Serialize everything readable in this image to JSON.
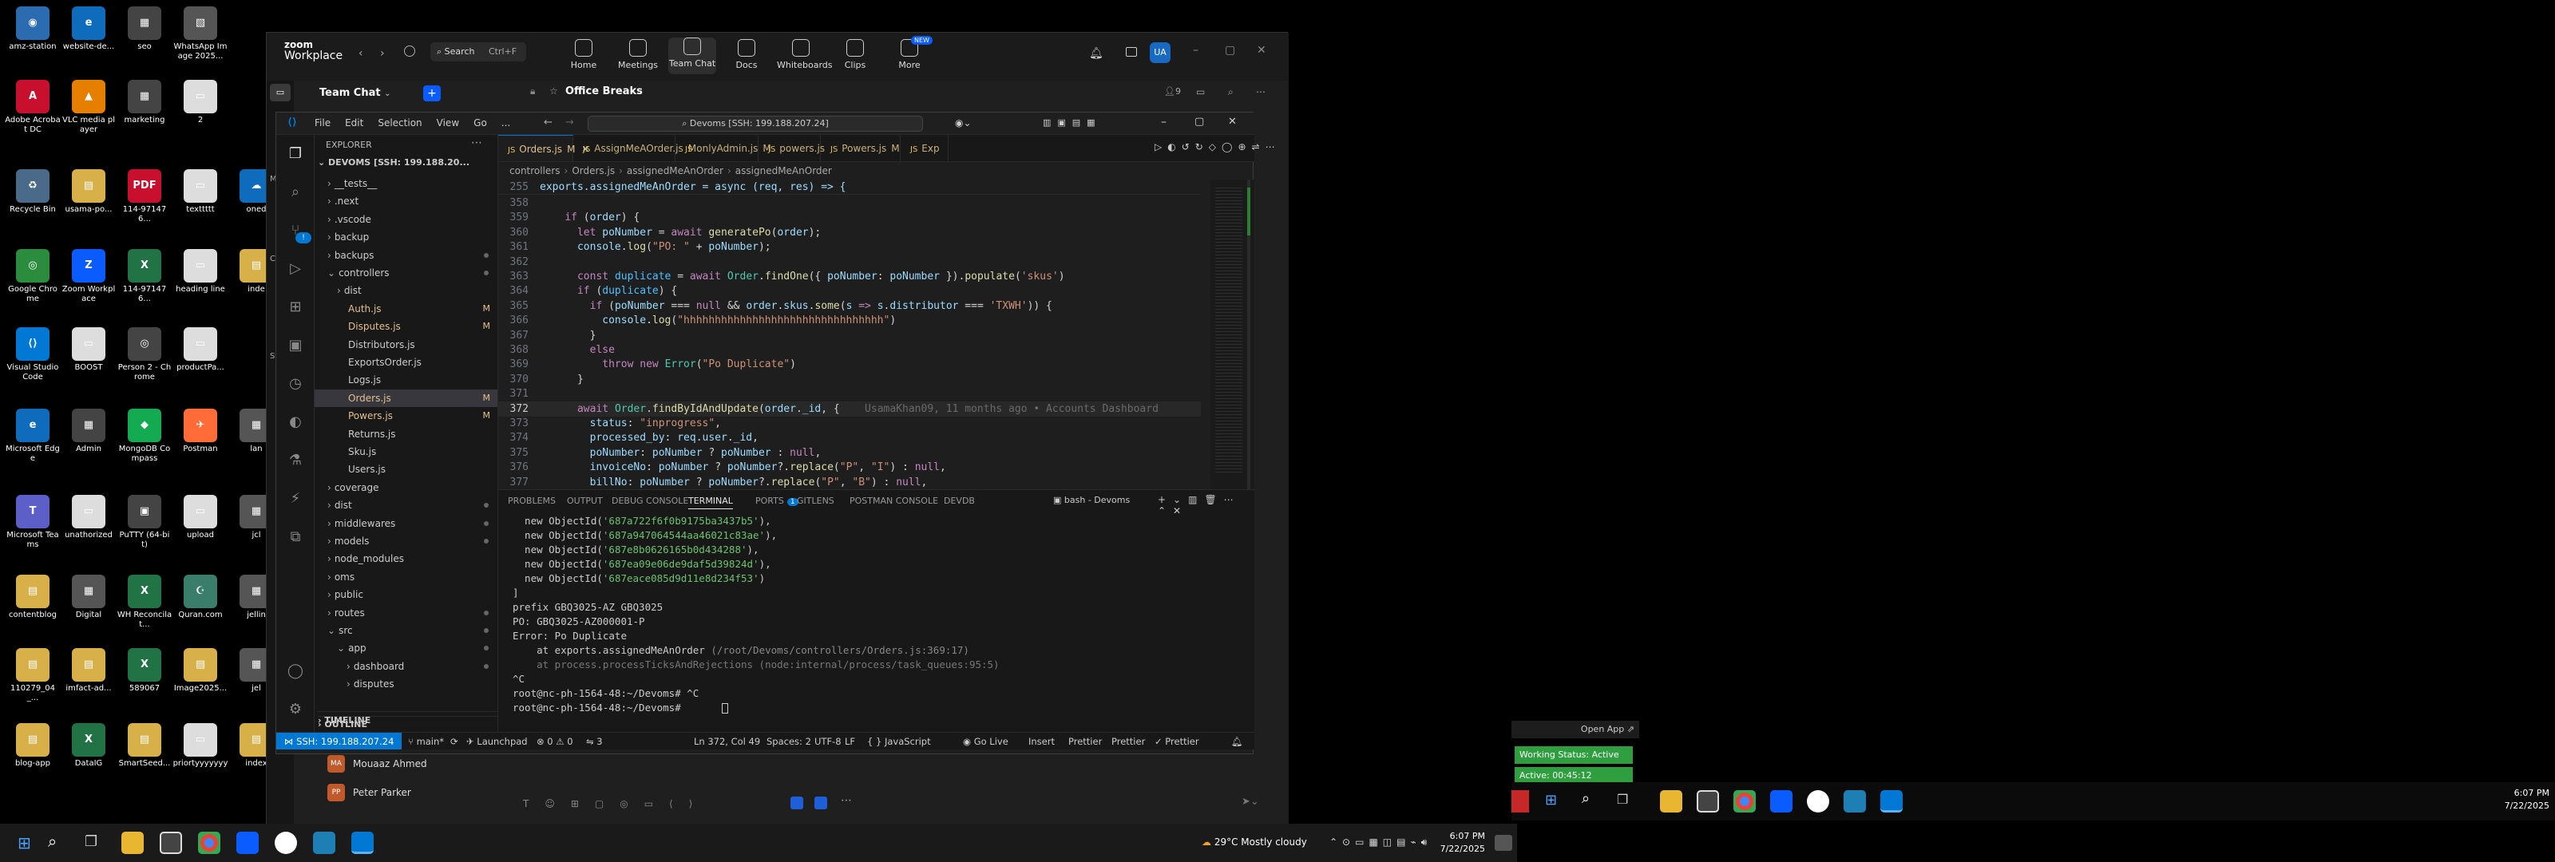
{
  "desktop": {
    "icons": [
      {
        "label": "amz-station",
        "color": "#2b6cb0",
        "glyph": "◉"
      },
      {
        "label": "website-de...",
        "color": "#0f6cbd",
        "glyph": "e"
      },
      {
        "label": "seo",
        "color": "#444",
        "glyph": "▦"
      },
      {
        "label": "WhatsApp Image 2025...",
        "color": "#555",
        "glyph": "▧"
      },
      {
        "label": "Adobe Acrobat DC",
        "color": "#c8102e",
        "glyph": "A"
      },
      {
        "label": "VLC media player",
        "color": "#e67e00",
        "glyph": "▲"
      },
      {
        "label": "marketing",
        "color": "#444",
        "glyph": "▦"
      },
      {
        "label": "2",
        "color": "#ddd",
        "glyph": "▭"
      },
      {
        "label": "Recycle Bin",
        "color": "#4a6a8a",
        "glyph": "♻"
      },
      {
        "label": "usama-po...",
        "color": "#d8b04a",
        "glyph": "▤"
      },
      {
        "label": "114-971476...",
        "color": "#c8102e",
        "glyph": "PDF"
      },
      {
        "label": "texttttt",
        "color": "#ddd",
        "glyph": "▭"
      },
      {
        "label": "oned",
        "color": "#0f6cbd",
        "glyph": "☁"
      },
      {
        "label": "Google Chrome",
        "color": "#2a8c3c",
        "glyph": "◎"
      },
      {
        "label": "Zoom Workplace",
        "color": "#0b5cff",
        "glyph": "Z"
      },
      {
        "label": "114-971476...",
        "color": "#217346",
        "glyph": "X"
      },
      {
        "label": "heading line",
        "color": "#ddd",
        "glyph": "▭"
      },
      {
        "label": "inde",
        "color": "#d8b04a",
        "glyph": "▤"
      },
      {
        "label": "Visual Studio Code",
        "color": "#0078d4",
        "glyph": "⟨⟩"
      },
      {
        "label": "BOOST",
        "color": "#ddd",
        "glyph": "▭"
      },
      {
        "label": "Person 2 - Chrome",
        "color": "#444",
        "glyph": "◎"
      },
      {
        "label": "productPa...",
        "color": "#ddd",
        "glyph": "▭"
      },
      {
        "label": "Microsoft Edge",
        "color": "#0f6cbd",
        "glyph": "e"
      },
      {
        "label": "Admin",
        "color": "#444",
        "glyph": "▦"
      },
      {
        "label": "MongoDB Compass",
        "color": "#13aa52",
        "glyph": "◆"
      },
      {
        "label": "Postman",
        "color": "#ff6c37",
        "glyph": "✈"
      },
      {
        "label": "lan",
        "color": "#555",
        "glyph": "▦"
      },
      {
        "label": "Microsoft Teams",
        "color": "#5b5fc7",
        "glyph": "T"
      },
      {
        "label": "unathorized",
        "color": "#ddd",
        "glyph": "▭"
      },
      {
        "label": "PuTTY (64-bit)",
        "color": "#444",
        "glyph": "▣"
      },
      {
        "label": "upload",
        "color": "#ddd",
        "glyph": "▭"
      },
      {
        "label": "jcl",
        "color": "#555",
        "glyph": "▦"
      },
      {
        "label": "contentblog",
        "color": "#d8b04a",
        "glyph": "▤"
      },
      {
        "label": "Digital",
        "color": "#555",
        "glyph": "▦"
      },
      {
        "label": "WH Reconcilat...",
        "color": "#217346",
        "glyph": "X"
      },
      {
        "label": "Quran.com",
        "color": "#3a7d6a",
        "glyph": "☪"
      },
      {
        "label": "jellin",
        "color": "#555",
        "glyph": "▦"
      },
      {
        "label": "110279_04_...",
        "color": "#d8b04a",
        "glyph": "▤"
      },
      {
        "label": "imfact-ad...",
        "color": "#d8b04a",
        "glyph": "▤"
      },
      {
        "label": "589067",
        "color": "#217346",
        "glyph": "X"
      },
      {
        "label": "Image2025...",
        "color": "#d8b04a",
        "glyph": "▤"
      },
      {
        "label": "jel",
        "color": "#555",
        "glyph": "▦"
      },
      {
        "label": "blog-app",
        "color": "#d8b04a",
        "glyph": "▤"
      },
      {
        "label": "DataIG",
        "color": "#217346",
        "glyph": "X"
      },
      {
        "label": "SmartSeed...",
        "color": "#d8b04a",
        "glyph": "▤"
      },
      {
        "label": "priortyyyyyyy",
        "color": "#ddd",
        "glyph": "▭"
      },
      {
        "label": "index",
        "color": "#d8b04a",
        "glyph": "▤"
      }
    ]
  },
  "zoom": {
    "brand_top": "zoom",
    "brand_bottom": "Workplace",
    "search_label": "Search",
    "search_shortcut": "Ctrl+F",
    "nav": [
      {
        "label": "Home"
      },
      {
        "label": "Meetings"
      },
      {
        "label": "Team Chat"
      },
      {
        "label": "Docs"
      },
      {
        "label": "Whiteboards"
      },
      {
        "label": "Clips"
      },
      {
        "label": "More",
        "badge": "NEW"
      }
    ],
    "avatar_initials": "UA",
    "team_chat_title": "Team Chat",
    "channel_name": "Office Breaks",
    "member_count": "9",
    "side_labels": [
      "Me",
      "Ch",
      "St"
    ],
    "contacts": [
      {
        "initials": "MA",
        "name": "Mouaaz Ahmed"
      },
      {
        "initials": "PP",
        "name": "Peter Parker"
      }
    ],
    "popup": {
      "open_app": "Open App",
      "working_status": "Working Status: Active",
      "active_time": "Active: 00:45:12"
    }
  },
  "vscode": {
    "menu": [
      "File",
      "Edit",
      "Selection",
      "View",
      "Go",
      "..."
    ],
    "search_text": "Devoms [SSH: 199.188.207.24]",
    "explorer_title": "EXPLORER",
    "root": "DEVOMS [SSH: 199.188.20...",
    "tree": [
      {
        "label": "__tests__",
        "indent": 1,
        "type": "folder",
        "open": false
      },
      {
        "label": ".next",
        "indent": 1,
        "type": "folder",
        "open": false
      },
      {
        "label": ".vscode",
        "indent": 1,
        "type": "folder",
        "open": false
      },
      {
        "label": "backup",
        "indent": 1,
        "type": "folder",
        "open": false
      },
      {
        "label": "backups",
        "indent": 1,
        "type": "folder",
        "open": false,
        "dot": true
      },
      {
        "label": "controllers",
        "indent": 1,
        "type": "folder",
        "open": true,
        "dot": true
      },
      {
        "label": "dist",
        "indent": 2,
        "type": "folder",
        "open": false
      },
      {
        "label": "Auth.js",
        "indent": 2,
        "type": "file",
        "mod": "M"
      },
      {
        "label": "Disputes.js",
        "indent": 2,
        "type": "file",
        "mod": "M"
      },
      {
        "label": "Distributors.js",
        "indent": 2,
        "type": "file"
      },
      {
        "label": "ExportsOrder.js",
        "indent": 2,
        "type": "file"
      },
      {
        "label": "Logs.js",
        "indent": 2,
        "type": "file"
      },
      {
        "label": "Orders.js",
        "indent": 2,
        "type": "file",
        "mod": "M",
        "selected": true
      },
      {
        "label": "Powers.js",
        "indent": 2,
        "type": "file",
        "mod": "M"
      },
      {
        "label": "Returns.js",
        "indent": 2,
        "type": "file"
      },
      {
        "label": "Sku.js",
        "indent": 2,
        "type": "file"
      },
      {
        "label": "Users.js",
        "indent": 2,
        "type": "file"
      },
      {
        "label": "coverage",
        "indent": 1,
        "type": "folder",
        "open": false
      },
      {
        "label": "dist",
        "indent": 1,
        "type": "folder",
        "open": false,
        "dot": true
      },
      {
        "label": "middlewares",
        "indent": 1,
        "type": "folder",
        "open": false,
        "dot": true
      },
      {
        "label": "models",
        "indent": 1,
        "type": "folder",
        "open": false,
        "dot": true
      },
      {
        "label": "node_modules",
        "indent": 1,
        "type": "folder",
        "open": false
      },
      {
        "label": "oms",
        "indent": 1,
        "type": "folder",
        "open": false
      },
      {
        "label": "public",
        "indent": 1,
        "type": "folder",
        "open": false
      },
      {
        "label": "routes",
        "indent": 1,
        "type": "folder",
        "open": false,
        "dot": true
      },
      {
        "label": "src",
        "indent": 1,
        "type": "folder",
        "open": true,
        "dot": true
      },
      {
        "label": "app",
        "indent": 2,
        "type": "folder",
        "open": true,
        "dot": true
      },
      {
        "label": "dashboard",
        "indent": 3,
        "type": "folder",
        "open": false,
        "dot": true
      },
      {
        "label": "disputes",
        "indent": 3,
        "type": "folder",
        "open": false
      }
    ],
    "outline": "OUTLINE",
    "timeline": "TIMELINE",
    "tabs": [
      {
        "label": "Orders.js",
        "mod": "M",
        "active": true
      },
      {
        "label": "AssignMeAOrder.js",
        "mod": "M"
      },
      {
        "label": "onlyAdmin.js",
        "mod": "M"
      },
      {
        "label": "powers.js",
        "mod": ""
      },
      {
        "label": "Powers.js",
        "mod": "M"
      },
      {
        "label": "Exp",
        "mod": ""
      }
    ],
    "breadcrumb": [
      "controllers",
      "Orders.js",
      "assignedMeAnOrder",
      "assignedMeAnOrder"
    ],
    "sticky_line": {
      "num": "255",
      "text": "exports.assignedMeAnOrder = async (req, res) => {"
    },
    "code": [
      {
        "num": "358",
        "html": ""
      },
      {
        "num": "359",
        "html": "    <span class='k'>if</span> <span class='p'>(</span><span class='v'>order</span><span class='p'>) {</span>"
      },
      {
        "num": "360",
        "html": "      <span class='k'>let</span> <span class='v'>poNumber</span> <span class='p'>=</span> <span class='k'>await</span> <span class='f'>generatePo</span><span class='p'>(</span><span class='v'>order</span><span class='p'>);</span>"
      },
      {
        "num": "361",
        "html": "      <span class='v'>console</span><span class='p'>.</span><span class='f'>log</span><span class='p'>(</span><span class='s'>\"PO: \"</span> <span class='p'>+</span> <span class='v'>poNumber</span><span class='p'>);</span>"
      },
      {
        "num": "362",
        "html": ""
      },
      {
        "num": "363",
        "html": "      <span class='k'>const</span> <span class='c'>duplicate</span> <span class='p'>=</span> <span class='k'>await</span> <span class='t'>Order</span><span class='p'>.</span><span class='f'>findOne</span><span class='p'>({</span> <span class='v'>poNumber</span><span class='p'>:</span> <span class='v'>poNumber</span> <span class='p'>}).</span><span class='f'>populate</span><span class='p'>(</span><span class='s'>'skus'</span><span class='p'>)</span>"
      },
      {
        "num": "364",
        "html": "      <span class='k'>if</span> <span class='p'>(</span><span class='c'>duplicate</span><span class='p'>) {</span>"
      },
      {
        "num": "365",
        "html": "        <span class='k'>if</span> <span class='p'>(</span><span class='v'>poNumber</span> <span class='p'>===</span> <span class='k'>null</span> <span class='p'>&amp;&amp;</span> <span class='v'>order</span><span class='p'>.</span><span class='v'>skus</span><span class='p'>.</span><span class='f'>some</span><span class='p'>(</span><span class='v'>s</span> <span class='k'>=&gt;</span> <span class='v'>s</span><span class='p'>.</span><span class='v'>distributor</span> <span class='p'>===</span> <span class='s'>'TXWH'</span><span class='p'>)) {</span>"
      },
      {
        "num": "366",
        "html": "          <span class='v'>console</span><span class='p'>.</span><span class='f'>log</span><span class='p'>(</span><span class='s'>\"hhhhhhhhhhhhhhhhhhhhhhhhhhhhhhhh\"</span><span class='p'>)</span>"
      },
      {
        "num": "367",
        "html": "        <span class='p'>}</span>"
      },
      {
        "num": "368",
        "html": "        <span class='k'>else</span>"
      },
      {
        "num": "369",
        "html": "          <span class='k'>throw</span> <span class='k'>new</span> <span class='t'>Error</span><span class='p'>(</span><span class='s'>\"Po Duplicate\"</span><span class='p'>)</span>"
      },
      {
        "num": "370",
        "html": "      <span class='p'>}</span>"
      },
      {
        "num": "371",
        "html": ""
      },
      {
        "num": "372",
        "html": "      <span class='k'>await</span> <span class='t'>Order</span><span class='p'>.</span><span class='f'>findByIdAndUpdate</span><span class='p'>(</span><span class='v'>order</span><span class='p'>.</span><span class='v'>_id</span><span class='p'>, {</span>    <span class='g'>UsamaKhan09, 11 months ago • Accounts Dashboard</span>",
        "current": true
      },
      {
        "num": "373",
        "html": "        <span class='v'>status</span><span class='p'>:</span> <span class='s'>\"inprogress\"</span><span class='p'>,</span>"
      },
      {
        "num": "374",
        "html": "        <span class='v'>processed_by</span><span class='p'>:</span> <span class='v'>req</span><span class='p'>.</span><span class='v'>user</span><span class='p'>.</span><span class='v'>_id</span><span class='p'>,</span>"
      },
      {
        "num": "375",
        "html": "        <span class='v'>poNumber</span><span class='p'>:</span> <span class='v'>poNumber</span> <span class='p'>?</span> <span class='v'>poNumber</span> <span class='p'>:</span> <span class='k'>null</span><span class='p'>,</span>"
      },
      {
        "num": "376",
        "html": "        <span class='v'>invoiceNo</span><span class='p'>:</span> <span class='v'>poNumber</span> <span class='p'>?</span> <span class='v'>poNumber</span><span class='p'>?.</span><span class='f'>replace</span><span class='p'>(</span><span class='s'>\"P\"</span><span class='p'>,</span> <span class='s'>\"I\"</span><span class='p'>)</span> <span class='p'>:</span> <span class='k'>null</span><span class='p'>,</span>"
      },
      {
        "num": "377",
        "html": "        <span class='v'>billNo</span><span class='p'>:</span> <span class='v'>poNumber</span> <span class='p'>?</span> <span class='v'>poNumber</span><span class='p'>?.</span><span class='f'>replace</span><span class='p'>(</span><span class='s'>\"P\"</span><span class='p'>,</span> <span class='s'>\"B\"</span><span class='p'>)</span> <span class='p'>:</span> <span class='k'>null</span><span class='p'>,</span>"
      }
    ],
    "panel_tabs": [
      "PROBLEMS",
      "OUTPUT",
      "DEBUG CONSOLE",
      "TERMINAL",
      "PORTS",
      "GITLENS",
      "POSTMAN CONSOLE",
      "DEVDB"
    ],
    "ports_badge": "1",
    "terminal_name": "bash - Devoms",
    "terminal": [
      {
        "pre": "  new ObjectId(",
        "str": "'687a722f6f0b9175ba3437b5'",
        "post": "),"
      },
      {
        "pre": "  new ObjectId(",
        "str": "'687a947064544aa46021c83ae'",
        "post": "),"
      },
      {
        "pre": "  new ObjectId(",
        "str": "'687e8b0626165b0d434288'",
        "post": "),"
      },
      {
        "pre": "  new ObjectId(",
        "str": "'687ea09e06de9daf5d39824d'",
        "post": "),"
      },
      {
        "pre": "  new ObjectId(",
        "str": "'687eace085d9d11e8d234f53'",
        "post": ")"
      },
      {
        "pre": "]",
        "str": "",
        "post": ""
      },
      {
        "pre": "prefix GBQ3025-AZ GBQ3025",
        "str": "",
        "post": ""
      },
      {
        "pre": "PO: GBQ3025-AZ000001-P",
        "str": "",
        "post": ""
      },
      {
        "pre": "Error: Po Duplicate",
        "str": "",
        "post": ""
      },
      {
        "pre": "    at exports.assignedMeAnOrder ",
        "str": "(/root/Devoms/controllers/Orders.js:369:17)",
        "post": "",
        "dim": true
      },
      {
        "pre": "    at process.processTicksAndRejections (node:internal/process/task_queues:95:5)",
        "str": "",
        "post": "",
        "grey": true
      },
      {
        "pre": "^C",
        "str": "",
        "post": ""
      },
      {
        "pre": "root@nc-ph-1564-48:~/Devoms# ^C",
        "str": "",
        "post": ""
      },
      {
        "pre": "root@nc-ph-1564-48:~/Devoms# ",
        "str": "",
        "post": ""
      }
    ],
    "status": {
      "remote": "SSH: 199.188.207.24",
      "branch": "main*",
      "launchpad": "Launchpad",
      "errors": "0",
      "warnings": "0",
      "ports": "3",
      "position": "Ln 372, Col 49",
      "spaces": "Spaces: 2",
      "encoding": "UTF-8",
      "eol": "LF",
      "language": "JavaScript",
      "golive": "Go Live",
      "insert": "Insert",
      "prettier1": "Prettier",
      "prettier2": "Prettier",
      "prettier3": "Prettier"
    }
  },
  "taskbar": {
    "weather": "29°C  Mostly cloudy",
    "time": "6:07 PM",
    "date": "7/22/2025",
    "time2": "6:07 PM",
    "date2": "7/22/2025"
  },
  "colors": {
    "vscode_blue": "#0078d4",
    "zoom_green": "#2e9e3e",
    "modified": "#e2c08d"
  }
}
